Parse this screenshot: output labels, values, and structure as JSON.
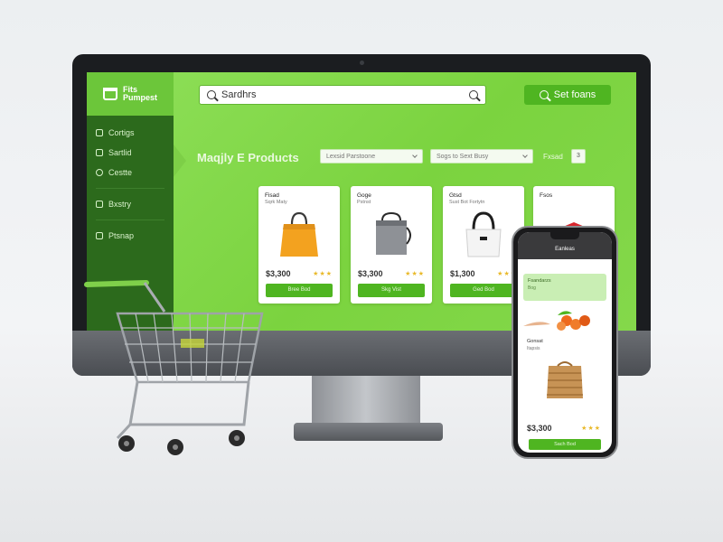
{
  "brand": {
    "name_line1": "Fits",
    "name_line2": "Pumpest",
    "color": "#6cc63a"
  },
  "search": {
    "value": "Sardhrs",
    "placeholder": "Sardhrs"
  },
  "header_button": {
    "label": "Set foans",
    "icon": "search-icon"
  },
  "sidebar": {
    "items": [
      {
        "label": "Cortigs",
        "icon": "tag-icon"
      },
      {
        "label": "Sartlid",
        "icon": "grid-icon"
      },
      {
        "label": "Cestte",
        "icon": "circle-icon"
      },
      {
        "label": "Bxstry",
        "icon": "box-icon"
      },
      {
        "label": "Ptsnap",
        "icon": "image-icon"
      }
    ]
  },
  "main": {
    "title": "Maqjly E Products",
    "filters": {
      "first": "Lexsid Parstoone",
      "second": "Sogs to Sext Busy",
      "label": "Fxsad",
      "page": "3"
    },
    "products": [
      {
        "name": "Fisad",
        "sub": "Sqrk Maty",
        "price": "$3,300",
        "buy_label": "Bree Bod",
        "stars": "★★★"
      },
      {
        "name": "Goge",
        "sub": "Pstnst",
        "price": "$3,300",
        "buy_label": "Skg Vist",
        "stars": "★★★"
      },
      {
        "name": "Gtsd",
        "sub": "Sust Bot Fortytn",
        "price": "$1,300",
        "buy_label": "Ged Bod",
        "stars": "★★★"
      },
      {
        "name": "Fsos",
        "sub": "",
        "price": "",
        "buy_label": "",
        "stars": ""
      }
    ]
  },
  "phone": {
    "header": "Eanleas",
    "panel_title": "Fsandarzs",
    "panel_sub": "Bog",
    "item_name": "Gonsat",
    "item_sub": "Itapsis",
    "price": "$3,300",
    "stars": "★★★",
    "button": "Sach Bod"
  },
  "colors": {
    "accent": "#4fb521",
    "sidebar": "#2c6a1c",
    "screen": "#7bd33f"
  }
}
